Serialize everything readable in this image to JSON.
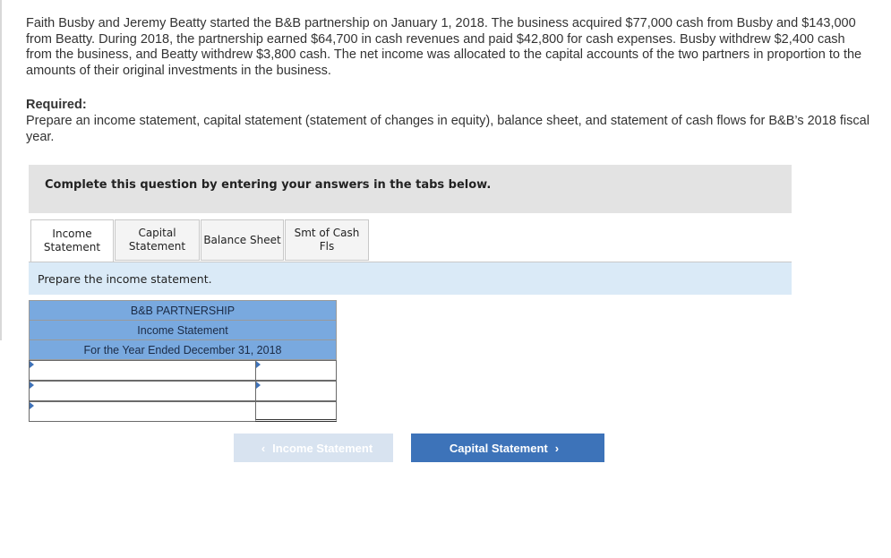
{
  "problem": {
    "text": "Faith Busby and Jeremy Beatty started the B&B partnership on January 1, 2018. The business acquired $77,000 cash from Busby and $143,000 from Beatty. During 2018, the partnership earned $64,700 in cash revenues and paid $42,800 for cash expenses. Busby withdrew $2,400 cash from the business, and Beatty withdrew $3,800 cash. The net income was allocated to the capital accounts of the two partners in proportion to the amounts of their original investments in the business.",
    "required_title": "Required:",
    "required_text": "Prepare an income statement, capital statement (statement of changes in equity), balance sheet, and statement of cash flows for B&B’s 2018 fiscal year."
  },
  "instruction": "Complete this question by entering your answers in the tabs below.",
  "tabs": [
    {
      "line1": "Income",
      "line2": "Statement"
    },
    {
      "line1": "Capital",
      "line2": "Statement"
    },
    {
      "line1": "Balance Sheet",
      "line2": ""
    },
    {
      "line1": "Smt of Cash",
      "line2": "Fls"
    }
  ],
  "prompt": "Prepare the income statement.",
  "statement": {
    "company": "B&B PARTNERSHIP",
    "title": "Income Statement",
    "period": "For the Year Ended December 31, 2018",
    "rows": [
      {
        "label": "",
        "value": ""
      },
      {
        "label": "",
        "value": ""
      },
      {
        "label": "",
        "value": ""
      }
    ]
  },
  "nav": {
    "prev_label": "Income Statement",
    "next_label": "Capital Statement",
    "prev_icon": "chevron-left-icon",
    "next_icon": "chevron-right-icon"
  },
  "colors": {
    "header_blue": "#79a9df",
    "prompt_bg": "#daeaf7",
    "next_button": "#3d73b9",
    "prev_button": "#d8e3f0"
  }
}
